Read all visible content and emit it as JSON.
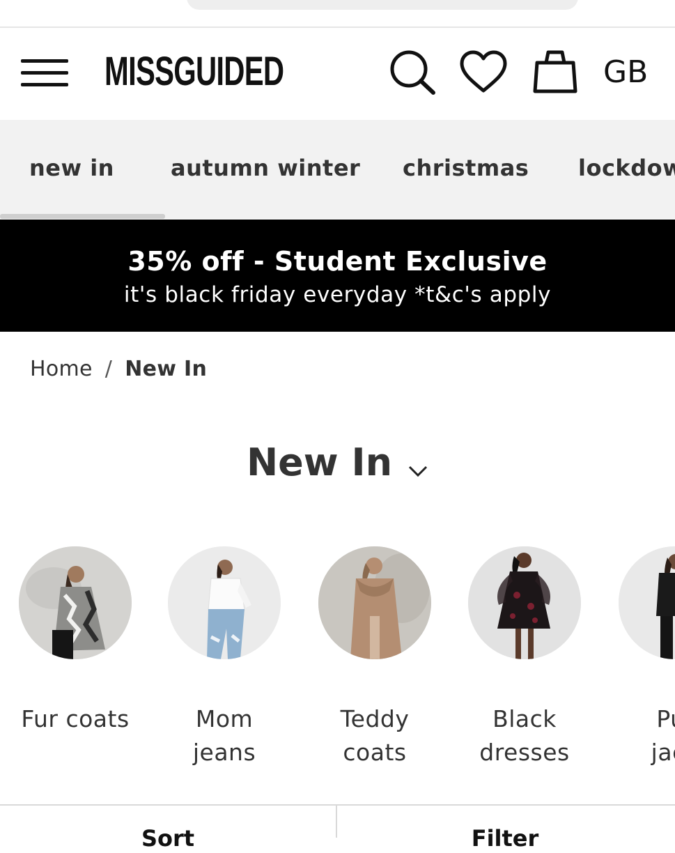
{
  "header": {
    "logo": "MISSGUIDED",
    "country": "GB"
  },
  "nav": {
    "items": [
      {
        "label": "new in"
      },
      {
        "label": "autumn winter"
      },
      {
        "label": "christmas"
      },
      {
        "label": "lockdow"
      }
    ],
    "active_index": 0
  },
  "promo": {
    "title": "35% off - Student Exclusive",
    "subtitle": "it's black friday everyday *t&c's apply"
  },
  "breadcrumb": {
    "home": "Home",
    "separator": "/",
    "current": "New In"
  },
  "page": {
    "title": "New In"
  },
  "categories": [
    {
      "line1": "Fur coats",
      "line2": ""
    },
    {
      "line1": "Mom",
      "line2": "jeans"
    },
    {
      "line1": "Teddy",
      "line2": "coats"
    },
    {
      "line1": "Black",
      "line2": "dresses"
    },
    {
      "line1": "Puf",
      "line2": "jack"
    }
  ],
  "bottom_bar": {
    "sort_label": "Sort",
    "filter_label": "Filter"
  },
  "icons": {
    "menu": "hamburger-menu-icon",
    "search": "search-icon",
    "wishlist": "heart-icon",
    "bag": "shopping-bag-icon",
    "chevron": "chevron-down-icon"
  },
  "colors": {
    "promo_bg": "#000000",
    "nav_bg": "#f2f2f2",
    "text": "#333333"
  }
}
